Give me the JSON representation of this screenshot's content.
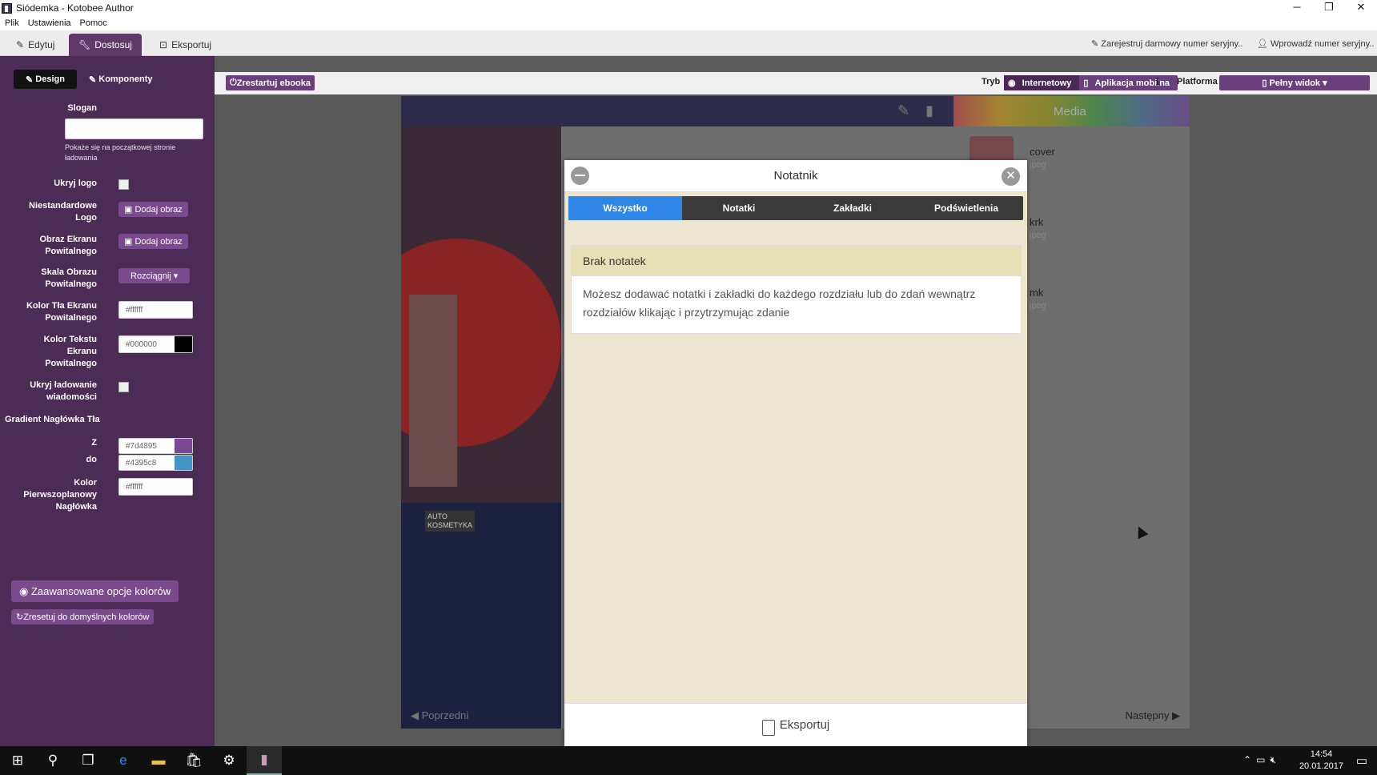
{
  "window": {
    "title": "Siódemka - Kotobee Author",
    "minimize": "─",
    "maximize": "❐",
    "close": "✕"
  },
  "menu": [
    "Plik",
    "Ustawienia",
    "Pomoc"
  ],
  "top_tabs": [
    {
      "label": "Edytuj",
      "icon": "pencil-icon"
    },
    {
      "label": "Dostosuj",
      "icon": "wrench-icon"
    },
    {
      "label": "Eksportuj",
      "icon": "export-icon"
    }
  ],
  "top_right": {
    "register": "Zarejestruj darmowy numer seryjny..",
    "enter": "Wprowadź numer seryjny.."
  },
  "sidebar": {
    "tabs": [
      "Design",
      "Komponenty"
    ],
    "slogan_label": "Slogan",
    "slogan_value": "",
    "slogan_hint": "Pokaże się na początkowej stronie ładowania",
    "hide_logo": "Ukryj logo",
    "custom_logo": "Niestandardowe Logo",
    "add_image": "Dodaj obraz",
    "splash_image": "Obraz Ekranu Powitalnego",
    "splash_scale": "Skala Obrazu Powitalnego",
    "scale_value": "Rozciągnij",
    "bg_color_label": "Kolor Tła Ekranu Powitalnego",
    "bg_color_value": "#ffffff",
    "text_color_label": "Kolor Tekstu Ekranu Powitalnego",
    "text_color_value": "#000000",
    "hide_loading": "Ukryj ładowanie wiadomości",
    "gradient_label": "Gradient Nagłówka Tła",
    "from_label": "Z",
    "from_value": "#7d4895",
    "to_label": "do",
    "to_value": "#4395c8",
    "fg_color_label": "Kolor Pierwszoplanowy Nagłówka",
    "fg_color_value": "#ffffff",
    "advanced_btn": "Zaawansowane opcje kolorów",
    "reset_btn": "Zresetuj do domyślnych kolorów"
  },
  "toolbar": {
    "restart": "Zrestartuj ebooka",
    "mode_label": "Tryb",
    "mode_web": "Internetowy",
    "mode_mobile": "Aplikacja mobilna",
    "platform_label": "Platforma",
    "platform_value": "Pełny widok"
  },
  "preview": {
    "media_title": "Media",
    "media_items": [
      {
        "name": "cover",
        "ext": "jpeg"
      },
      {
        "name": "krk",
        "ext": "jpeg"
      },
      {
        "name": "mk",
        "ext": "jpeg"
      }
    ],
    "prev": "Poprzedni",
    "next": "Następny",
    "sign_text": "AUTO KOSMETYKA"
  },
  "modal": {
    "title": "Notatnik",
    "tabs": [
      "Wszystko",
      "Notatki",
      "Zakładki",
      "Podświetlenia"
    ],
    "empty_title": "Brak notatek",
    "empty_body": "Możesz dodawać notatki i zakładki do każdego rozdziału lub do zdań wewnątrz rozdziałów klikając i przytrzymując zdanie",
    "export": "Eksportuj"
  },
  "taskbar": {
    "time": "14:54",
    "date": "20.01.2017"
  },
  "colors": {
    "sidebar": "#4c2b57",
    "accent": "#6b3f7c",
    "modal_tab_active": "#2f86e6",
    "note_header": "#e6e0b6"
  }
}
